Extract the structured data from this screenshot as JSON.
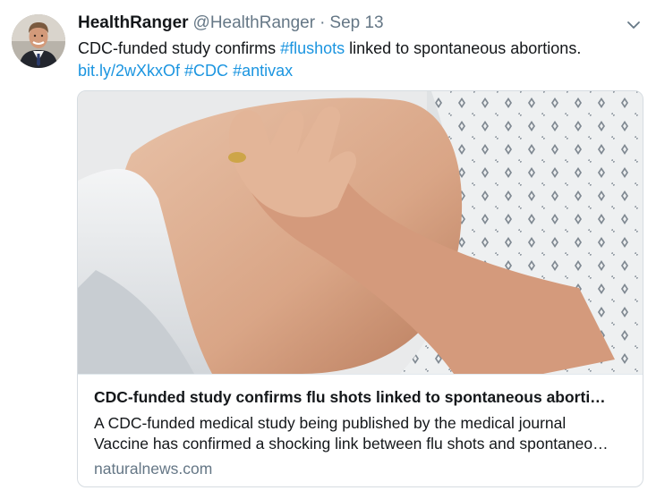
{
  "tweet": {
    "name": "HealthRanger",
    "handle": "@HealthRanger",
    "separator": "·",
    "date": "Sep 13",
    "text_plain": "CDC-funded study confirms ",
    "hashtag_flushots": "#flushots",
    "text_rest": " linked to spontaneous abortions.",
    "short_link": "bit.ly/2wXkxOf",
    "hashtag_cdc": "#CDC",
    "hashtag_antivax": "#antivax"
  },
  "card": {
    "title": "CDC-funded study confirms flu shots linked to spontaneous aborti…",
    "description_line1": "A CDC-funded medical study being published by the medical journal",
    "description_line2": "Vaccine has confirmed a shocking link between flu shots and spontaneo…",
    "domain": "naturalnews.com"
  },
  "icons": {
    "caret": "chevron-down-icon"
  },
  "colors": {
    "link": "#1b95e0",
    "secondary_text": "#657786",
    "border": "#d6dce1"
  }
}
